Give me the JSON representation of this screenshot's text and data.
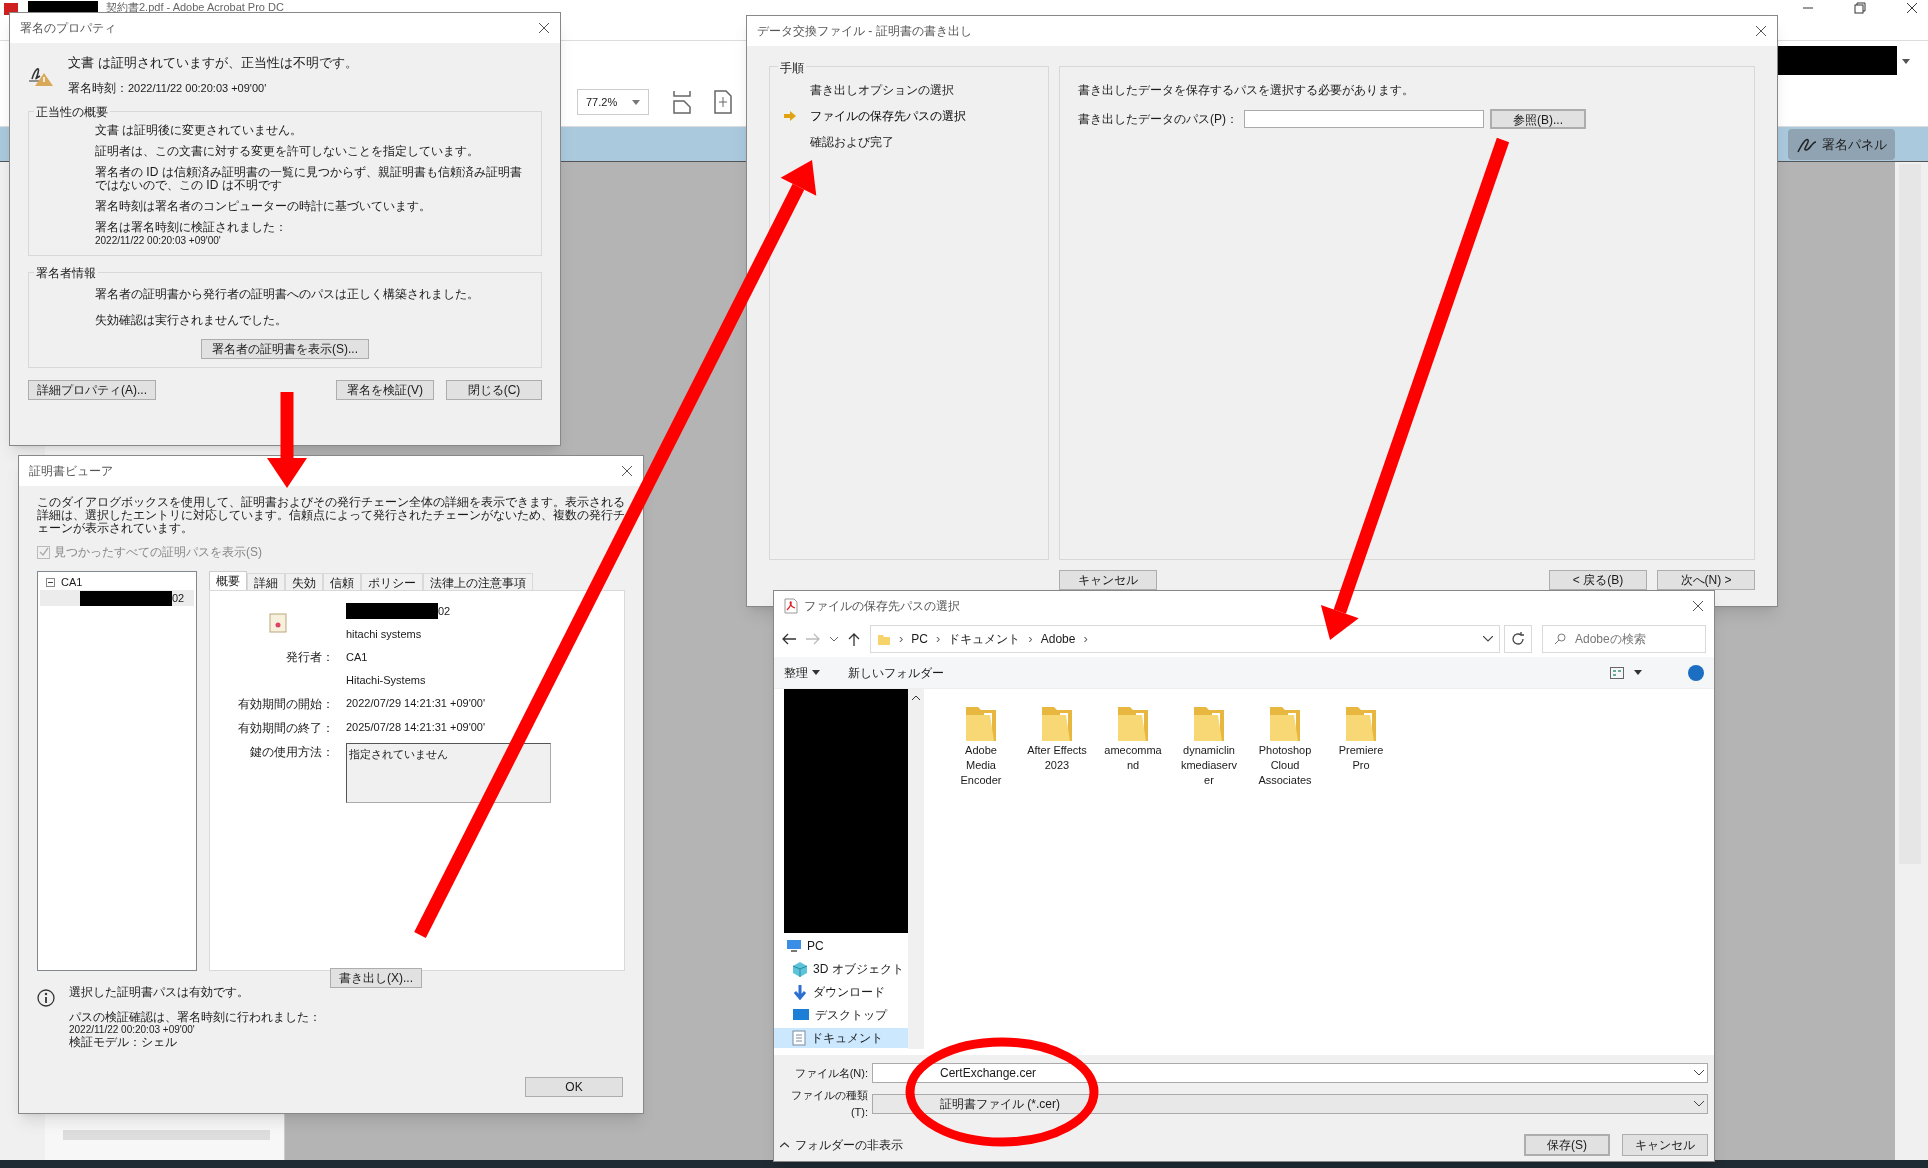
{
  "app": {
    "title": "契約書2.pdf - Adobe Acrobat Pro DC",
    "zoom": "77.2%",
    "sign_panel_button": "署名パネル"
  },
  "signature_properties": {
    "title": "署名のプロパティ",
    "status": "文書 は証明されていますが、正当性は不明です。",
    "time_label": "署名時刻：",
    "time": "2022/11/22 00:20:03 +09'00'",
    "validity": {
      "title": "正当性の概要",
      "lines": [
        {
          "text": "文書 は証明後に変更されていません。"
        },
        {
          "text": "証明者は、この文書に対する変更を許可しないことを指定しています。"
        },
        {
          "text": "署名者の ID は信頼済み証明書の一覧に見つからず、親証明書も信頼済み証明書ではないので、この ID は不明です"
        },
        {
          "text": "署名時刻は署名者のコンピューターの時計に基づいています。"
        },
        {
          "text": "署名は署名時刻に検証されました：",
          "detail": "2022/11/22 00:20:03 +09'00'"
        }
      ]
    },
    "signer": {
      "title": "署名者情報",
      "lines": [
        "署名者の証明書から発行者の証明書へのパスは正しく構築されました。",
        "失効確認は実行されませんでした。"
      ],
      "button": "署名者の証明書を表示(S)..."
    },
    "buttons": [
      "詳細プロパティ(A)...",
      "署名を検証(V)",
      "閉じる(C)"
    ]
  },
  "certificate_viewer": {
    "title": "証明書ビューア",
    "description": "このダイアログボックスを使用して、証明書およびその発行チェーン全体の詳細を表示できます。表示される詳細は、選択したエントリに対応しています。信頼点によって発行されたチェーンがないため、複数の発行チェーンが表示されています。",
    "show_all_paths": {
      "label": "見つかったすべての証明パスを表示(S)",
      "checked": true,
      "disabled": true
    },
    "tree": [
      {
        "label": "CA1",
        "expanded": true,
        "selected": false,
        "children": [
          {
            "label": "02",
            "redacted": true,
            "selected": true
          }
        ]
      }
    ],
    "tabs": [
      {
        "label": "概要",
        "selected": true
      },
      {
        "label": "詳細",
        "selected": false
      },
      {
        "label": "失効",
        "selected": false
      },
      {
        "label": "信頼",
        "selected": false
      },
      {
        "label": "ポリシー",
        "selected": false
      },
      {
        "label": "法律上の注意事項",
        "selected": false
      }
    ],
    "summary": {
      "name_suffix": "02",
      "organization": "hitachi systems",
      "fields": [
        {
          "label": "発行者：",
          "values": [
            "CA1",
            "Hitachi-Systems"
          ]
        },
        {
          "label": "有効期間の開始：",
          "values": [
            "2022/07/29 14:21:31 +09'00'"
          ]
        },
        {
          "label": "有効期間の終了：",
          "values": [
            "2025/07/28 14:21:31 +09'00'"
          ]
        }
      ],
      "key_usage_label": "鍵の使用方法：",
      "key_usage": "指定されていません",
      "export_button": "書き出し(X)..."
    },
    "status": {
      "message": "選択した証明書パスは有効です。",
      "lines": [
        "パスの検証確認は、署名時刻に行われました：",
        "2022/11/22 00:20:03 +09'00'",
        "検証モデル：シェル"
      ]
    },
    "ok_button": "OK"
  },
  "export_wizard": {
    "title": "データ交換ファイル - 証明書の書き出し",
    "steps_title": "手順",
    "steps": [
      {
        "label": "書き出しオプションの選択",
        "selected": false
      },
      {
        "label": "ファイルの保存先パスの選択",
        "selected": true
      },
      {
        "label": "確認および完了",
        "selected": false
      }
    ],
    "instruction": "書き出したデータを保存するパスを選択する必要があります。",
    "path_label": "書き出したデータのパス(P)：",
    "browse_button": "参照(B)...",
    "buttons": [
      "キャンセル",
      "< 戻る(B)",
      "次へ(N) >"
    ]
  },
  "save_dialog": {
    "title": "ファイルの保存先パスの選択",
    "breadcrumb": [
      "PC",
      "ドキュメント",
      "Adobe"
    ],
    "separator": "›",
    "search_placeholder": "Adobeの検索",
    "toolbar": [
      "整理",
      "新しいフォルダー"
    ],
    "nav": [
      {
        "label": "PC",
        "kind": "pc",
        "selected": false,
        "children": [
          {
            "label": "3D オブジェクト",
            "kind": "objects3d",
            "selected": false
          },
          {
            "label": "ダウンロード",
            "kind": "download",
            "selected": false
          },
          {
            "label": "デスクトップ",
            "kind": "desktop",
            "selected": false
          },
          {
            "label": "ドキュメント",
            "kind": "documents",
            "selected": true
          }
        ]
      }
    ],
    "folders": [
      "Adobe Media Encoder",
      "After Effects 2023",
      "amecomma nd",
      "dynamiclin kmediaserv er",
      "Photoshop Cloud Associates",
      "Premiere Pro"
    ],
    "filename_label": "ファイル名(N):",
    "filename": "CertExchange.cer",
    "type_label": "ファイルの種類(T):",
    "type": "証明書ファイル (*.cer)",
    "hide_folders": "フォルダーの非表示",
    "buttons": [
      "保存(S)",
      "キャンセル"
    ]
  }
}
